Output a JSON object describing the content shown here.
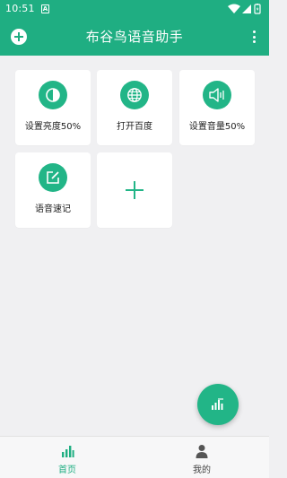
{
  "status_bar": {
    "time": "10:51",
    "notification_letter": "A"
  },
  "app_bar": {
    "title": "布谷鸟语音助手",
    "add_icon": "plus-circle-icon",
    "more_icon": "more-vert-icon"
  },
  "commands": [
    {
      "label": "设置亮度50%",
      "icon": "brightness-icon"
    },
    {
      "label": "打开百度",
      "icon": "globe-icon"
    },
    {
      "label": "设置音量50%",
      "icon": "volume-icon"
    },
    {
      "label": "语音速记",
      "icon": "edit-note-icon"
    }
  ],
  "add_card_icon": "plus-icon",
  "fab_icon": "voice-bars-icon",
  "bottom_nav": {
    "home_label": "首页",
    "mine_label": "我的"
  },
  "colors": {
    "primary": "#1fae82",
    "accent": "#22b587"
  }
}
